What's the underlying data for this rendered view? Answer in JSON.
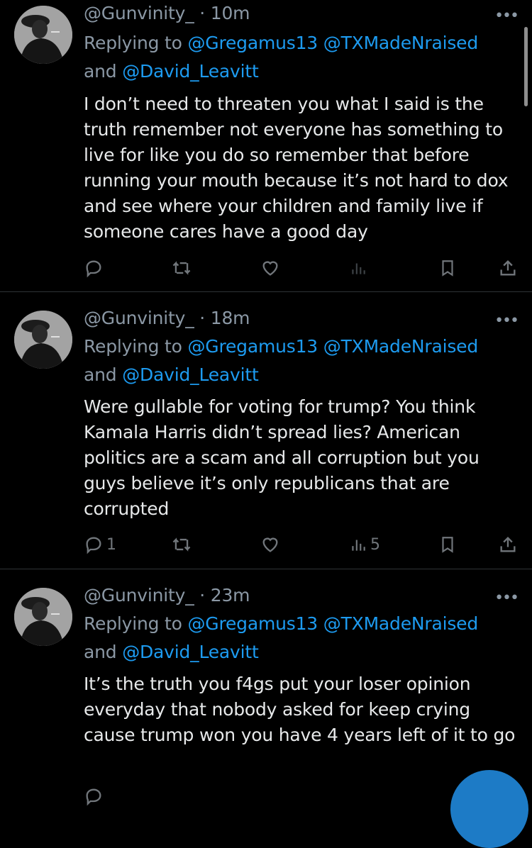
{
  "tweets": [
    {
      "handle": "@Gunvinity_",
      "time": "10m",
      "replying_prefix": "Replying to ",
      "mention1": "@Gregamus13",
      "mention2": "@TXMadeNraised",
      "and_text": "and ",
      "mention3": "@David_Leavitt",
      "text": "I don’t need to threaten you what I said is the truth remember not everyone has something to live for like you do so remember that before running your mouth because it’s not hard to dox and see where your children and family live if someone cares have a good day",
      "replies": "",
      "retweets": "",
      "likes": "",
      "views": ""
    },
    {
      "handle": "@Gunvinity_",
      "time": "18m",
      "replying_prefix": "Replying to ",
      "mention1": "@Gregamus13",
      "mention2": "@TXMadeNraised",
      "and_text": "and ",
      "mention3": "@David_Leavitt",
      "text": "Were gullable for voting for trump? You think Kamala Harris didn’t spread lies? American politics are a scam and all corruption but you guys believe it’s only republicans that are corrupted",
      "replies": "1",
      "retweets": "",
      "likes": "",
      "views": "5"
    },
    {
      "handle": "@Gunvinity_",
      "time": "23m",
      "replying_prefix": "Replying to ",
      "mention1": "@Gregamus13",
      "mention2": "@TXMadeNraised",
      "and_text": "and ",
      "mention3": "@David_Leavitt",
      "text": "It’s the truth you f4gs put your loser opinion everyday that nobody asked for keep crying cause trump won you have 4 years left of it to go",
      "replies": "",
      "retweets": "",
      "likes": "",
      "views": ""
    }
  ],
  "separator": " · ",
  "more_glyph": "•••",
  "icons": {
    "reply": "reply-icon",
    "retweet": "retweet-icon",
    "like": "heart-icon",
    "views": "views-icon",
    "bookmark": "bookmark-icon",
    "share": "share-icon"
  },
  "colors": {
    "background": "#000000",
    "text": "#e7e9ea",
    "muted": "#8b98a5",
    "link": "#1d9bf0",
    "divider": "#2f3336",
    "fab": "#1d7bc6"
  }
}
